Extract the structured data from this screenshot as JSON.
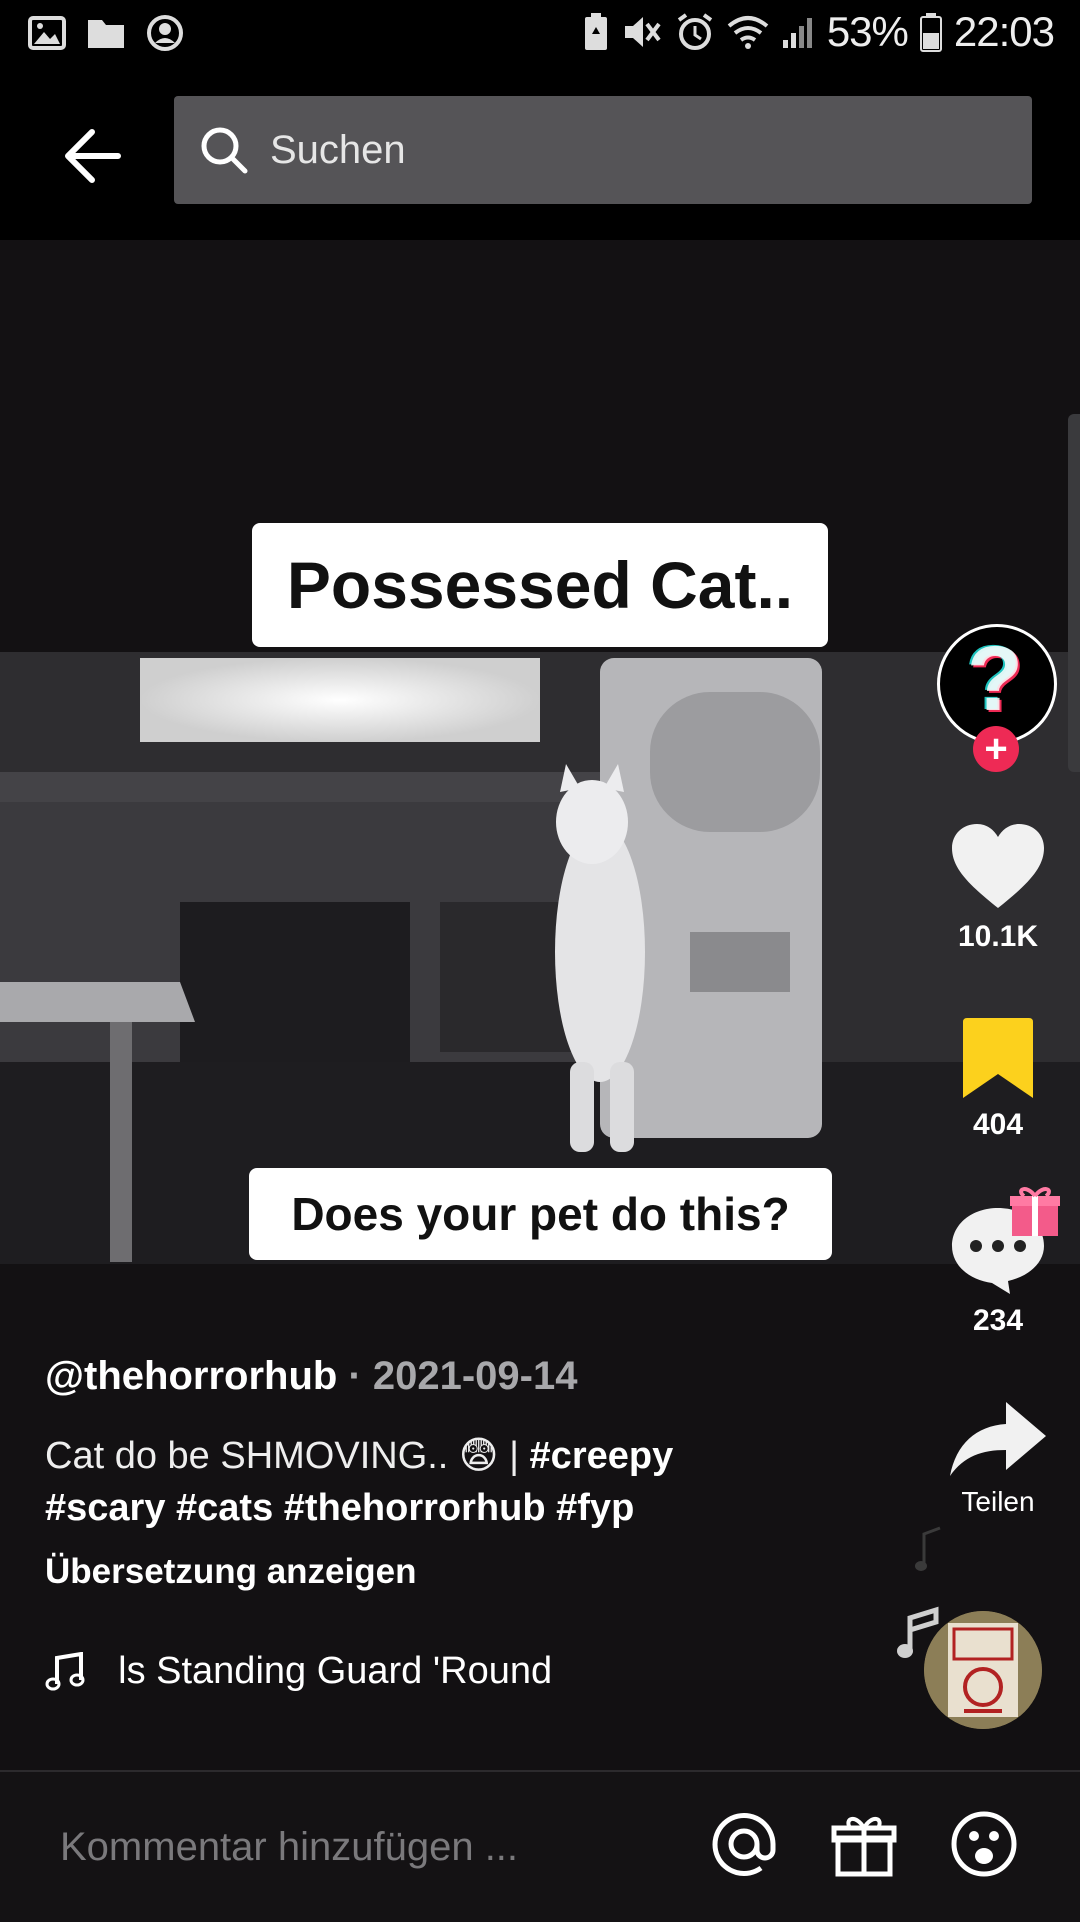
{
  "status_bar": {
    "battery": "53%",
    "time": "22:03"
  },
  "search": {
    "placeholder": "Suchen"
  },
  "video": {
    "caption_top": "Possessed Cat..",
    "caption_bottom": "Does your pet do this?"
  },
  "actions": {
    "likes": "10.1K",
    "saves": "404",
    "comments": "234",
    "share_label": "Teilen"
  },
  "post": {
    "author": "@thehorrorhub",
    "separator": " · ",
    "date": "2021-09-14",
    "desc_text": "Cat do be SHMOVING.. ",
    "desc_emoji": "😨",
    "desc_pipe": " | ",
    "hashtags": [
      "#creepy",
      "#scary",
      "#cats",
      "#thehorrorhub",
      "#fyp"
    ],
    "translate": "Übersetzung anzeigen",
    "music": "els Standing Guard 'Round"
  },
  "comment_bar": {
    "placeholder": "Kommentar hinzufügen ..."
  },
  "colors": {
    "like": "#f1f1f1",
    "save": "#fcd11d",
    "follow": "#ee2a55",
    "background": "#121012"
  }
}
